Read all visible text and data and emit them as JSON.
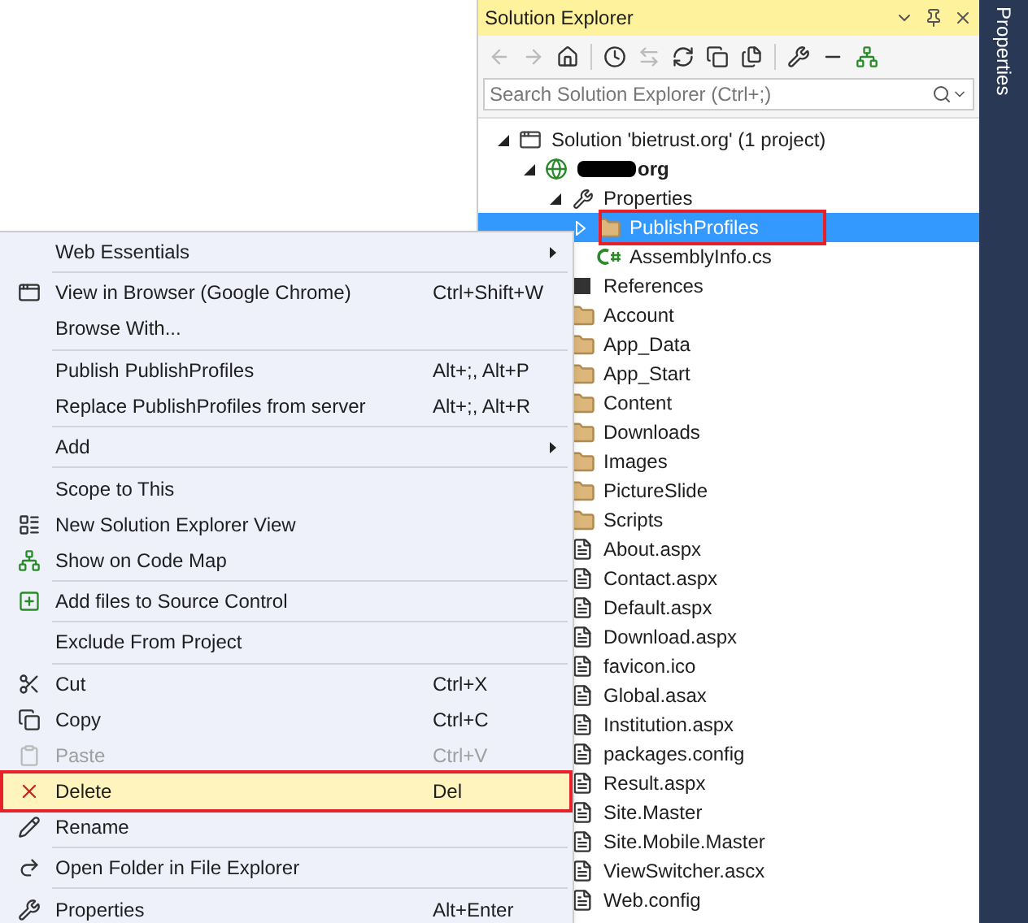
{
  "solution_explorer": {
    "title": "Solution Explorer",
    "search": {
      "placeholder": "Search Solution Explorer (Ctrl+;)"
    },
    "tree": [
      {
        "kind": "solution",
        "label": "Solution 'bietrust.org' (1 project)",
        "expanded": true,
        "selected": false,
        "annotated": false,
        "children": [
          {
            "kind": "project",
            "label": "org",
            "redacted": true,
            "expanded": true,
            "selected": false,
            "annotated": false,
            "children": [
              {
                "kind": "properties",
                "label": "Properties",
                "expanded": true,
                "selected": false,
                "annotated": false,
                "children": [
                  {
                    "kind": "folder",
                    "label": "PublishProfiles",
                    "expanded": false,
                    "selected": true,
                    "annotated": true
                  },
                  {
                    "kind": "csharp",
                    "label": "AssemblyInfo.cs",
                    "selected": false,
                    "annotated": false
                  }
                ]
              },
              {
                "kind": "references",
                "label": "References",
                "selected": false,
                "annotated": false
              },
              {
                "kind": "folder",
                "label": "Account",
                "selected": false,
                "annotated": false
              },
              {
                "kind": "folder",
                "label": "App_Data",
                "selected": false,
                "annotated": false
              },
              {
                "kind": "folder",
                "label": "App_Start",
                "selected": false,
                "annotated": false
              },
              {
                "kind": "folder",
                "label": "Content",
                "selected": false,
                "annotated": false
              },
              {
                "kind": "folder",
                "label": "Downloads",
                "selected": false,
                "annotated": false
              },
              {
                "kind": "folder",
                "label": "Images",
                "selected": false,
                "annotated": false
              },
              {
                "kind": "folder",
                "label": "PictureSlide",
                "selected": false,
                "annotated": false
              },
              {
                "kind": "folder",
                "label": "Scripts",
                "selected": false,
                "annotated": false
              },
              {
                "kind": "file",
                "label": "About.aspx",
                "selected": false,
                "annotated": false
              },
              {
                "kind": "file",
                "label": "Contact.aspx",
                "selected": false,
                "annotated": false
              },
              {
                "kind": "file",
                "label": "Default.aspx",
                "selected": false,
                "annotated": false
              },
              {
                "kind": "file",
                "label": "Download.aspx",
                "selected": false,
                "annotated": false
              },
              {
                "kind": "file",
                "label": "favicon.ico",
                "selected": false,
                "annotated": false
              },
              {
                "kind": "file",
                "label": "Global.asax",
                "selected": false,
                "annotated": false
              },
              {
                "kind": "file",
                "label": "Institution.aspx",
                "selected": false,
                "annotated": false
              },
              {
                "kind": "file",
                "label": "packages.config",
                "selected": false,
                "annotated": false
              },
              {
                "kind": "file",
                "label": "Result.aspx",
                "selected": false,
                "annotated": false
              },
              {
                "kind": "file",
                "label": "Site.Master",
                "selected": false,
                "annotated": false
              },
              {
                "kind": "file",
                "label": "Site.Mobile.Master",
                "selected": false,
                "annotated": false
              },
              {
                "kind": "file",
                "label": "ViewSwitcher.ascx",
                "selected": false,
                "annotated": false
              },
              {
                "kind": "file",
                "label": "Web.config",
                "selected": false,
                "annotated": false
              }
            ]
          }
        ]
      }
    ]
  },
  "side_tab": {
    "label": "Properties"
  },
  "context_menu": [
    {
      "kind": "item",
      "label": "Web Essentials",
      "submenu": true,
      "disabled": false,
      "selected": false,
      "annotated": false
    },
    {
      "kind": "separator"
    },
    {
      "kind": "item",
      "label": "View in Browser (Google Chrome)",
      "shortcut": "Ctrl+Shift+W",
      "disabled": false,
      "selected": false,
      "annotated": false
    },
    {
      "kind": "item",
      "label": "Browse With...",
      "disabled": false,
      "selected": false,
      "annotated": false
    },
    {
      "kind": "separator"
    },
    {
      "kind": "item",
      "label": "Publish PublishProfiles",
      "shortcut": "Alt+;, Alt+P",
      "disabled": false,
      "selected": false,
      "annotated": false
    },
    {
      "kind": "item",
      "label": "Replace PublishProfiles from server",
      "shortcut": "Alt+;, Alt+R",
      "disabled": false,
      "selected": false,
      "annotated": false
    },
    {
      "kind": "separator"
    },
    {
      "kind": "item",
      "label": "Add",
      "submenu": true,
      "disabled": false,
      "selected": false,
      "annotated": false
    },
    {
      "kind": "separator"
    },
    {
      "kind": "item",
      "label": "Scope to This",
      "disabled": false,
      "selected": false,
      "annotated": false
    },
    {
      "kind": "item",
      "label": "New Solution Explorer View",
      "disabled": false,
      "selected": false,
      "annotated": false
    },
    {
      "kind": "item",
      "label": "Show on Code Map",
      "disabled": false,
      "selected": false,
      "annotated": false
    },
    {
      "kind": "separator"
    },
    {
      "kind": "item",
      "label": "Add files to Source Control",
      "disabled": false,
      "selected": false,
      "annotated": false
    },
    {
      "kind": "separator"
    },
    {
      "kind": "item",
      "label": "Exclude From Project",
      "disabled": false,
      "selected": false,
      "annotated": false
    },
    {
      "kind": "separator"
    },
    {
      "kind": "item",
      "label": "Cut",
      "shortcut": "Ctrl+X",
      "disabled": false,
      "selected": false,
      "annotated": false
    },
    {
      "kind": "item",
      "label": "Copy",
      "shortcut": "Ctrl+C",
      "disabled": false,
      "selected": false,
      "annotated": false
    },
    {
      "kind": "item",
      "label": "Paste",
      "shortcut": "Ctrl+V",
      "disabled": true,
      "selected": false,
      "annotated": false
    },
    {
      "kind": "item",
      "label": "Delete",
      "shortcut": "Del",
      "disabled": false,
      "selected": true,
      "annotated": true
    },
    {
      "kind": "item",
      "label": "Rename",
      "disabled": false,
      "selected": false,
      "annotated": false
    },
    {
      "kind": "separator"
    },
    {
      "kind": "item",
      "label": "Open Folder in File Explorer",
      "disabled": false,
      "selected": false,
      "annotated": false
    },
    {
      "kind": "separator"
    },
    {
      "kind": "item",
      "label": "Properties",
      "shortcut": "Alt+Enter",
      "disabled": false,
      "selected": false,
      "annotated": false
    }
  ]
}
